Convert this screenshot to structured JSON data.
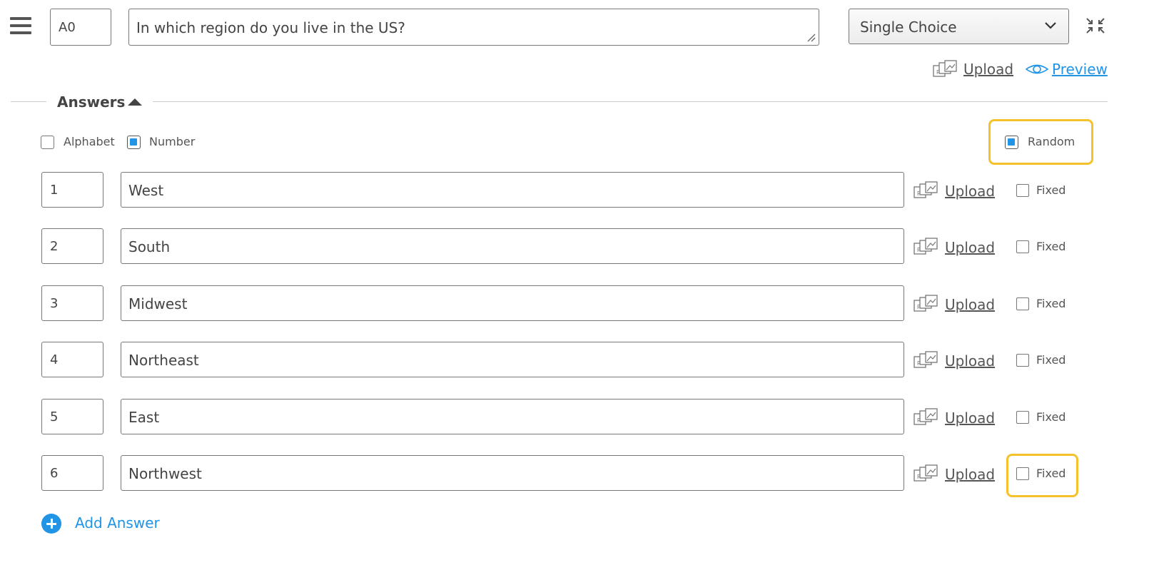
{
  "question": {
    "id": "A0",
    "text": "In which region do you live in the US?",
    "type": "Single Choice"
  },
  "toolbar": {
    "upload_label": "Upload",
    "preview_label": "Preview"
  },
  "answers_section": {
    "title": "Answers",
    "numbering": {
      "alphabet_label": "Alphabet",
      "alphabet_checked": false,
      "number_label": "Number",
      "number_checked": true
    },
    "random_label": "Random",
    "random_checked": true
  },
  "answers": [
    {
      "code": "1",
      "text": "West",
      "upload_label": "Upload",
      "fixed_label": "Fixed",
      "fixed": false
    },
    {
      "code": "2",
      "text": "South",
      "upload_label": "Upload",
      "fixed_label": "Fixed",
      "fixed": false
    },
    {
      "code": "3",
      "text": "Midwest",
      "upload_label": "Upload",
      "fixed_label": "Fixed",
      "fixed": false
    },
    {
      "code": "4",
      "text": "Northeast",
      "upload_label": "Upload",
      "fixed_label": "Fixed",
      "fixed": false
    },
    {
      "code": "5",
      "text": "East",
      "upload_label": "Upload",
      "fixed_label": "Fixed",
      "fixed": false
    },
    {
      "code": "6",
      "text": "Northwest",
      "upload_label": "Upload",
      "fixed_label": "Fixed",
      "fixed": false
    }
  ],
  "add_answer_label": "Add Answer",
  "colors": {
    "accent": "#2194e6",
    "highlight": "#f5c22e",
    "border": "#777777"
  },
  "icons": [
    "menu-icon",
    "collapse-icon",
    "image-upload-icon",
    "eye-icon",
    "caret-up-icon",
    "chevron-down-icon",
    "plus-circle-icon"
  ]
}
